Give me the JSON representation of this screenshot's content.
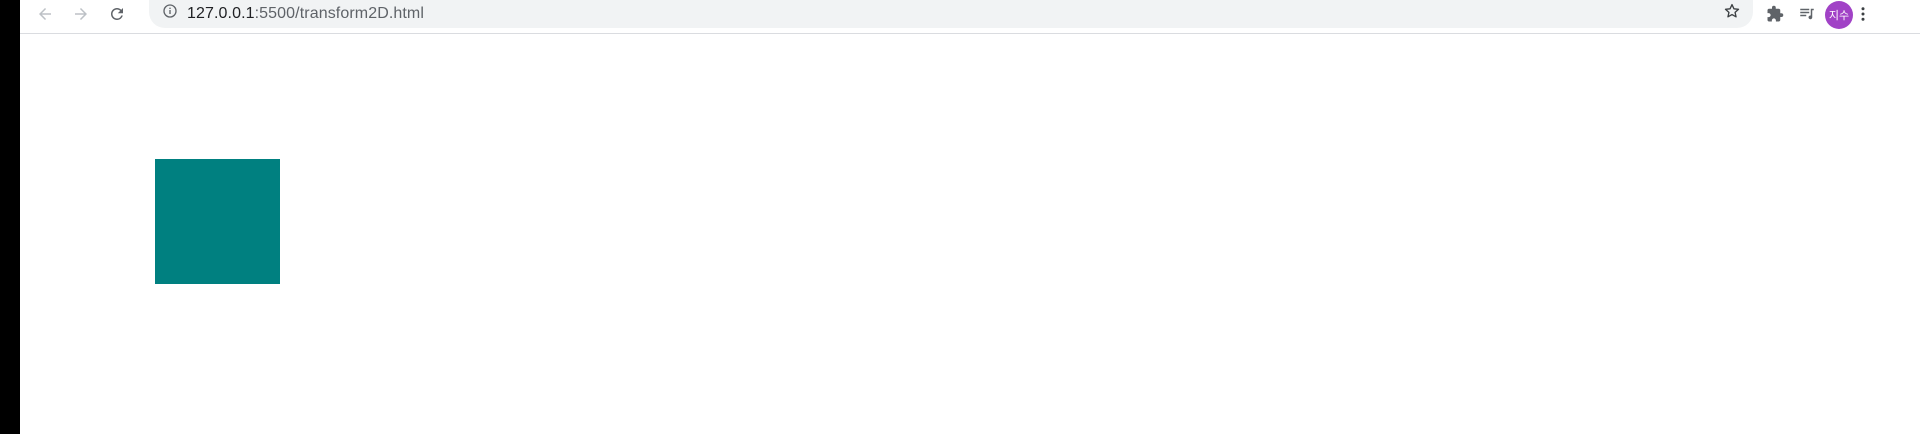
{
  "browser": {
    "url_host": "127.0.0.1",
    "url_path": ":5500/transform2D.html",
    "profile_initials": "지수",
    "icons": {
      "back": "arrow-left-icon",
      "forward": "arrow-right-icon",
      "reload": "reload-icon",
      "site_info": "info-circle-icon",
      "bookmark": "star-outline-icon",
      "extensions": "puzzle-icon",
      "media": "queue-music-icon",
      "menu": "more-vert-icon"
    }
  },
  "page": {
    "box_color": "#008080",
    "background": "#ffffff"
  },
  "colors": {
    "avatar": "#a142c6",
    "toolbar_icon": "#5f6368",
    "disabled_icon": "#bdc1c6"
  }
}
